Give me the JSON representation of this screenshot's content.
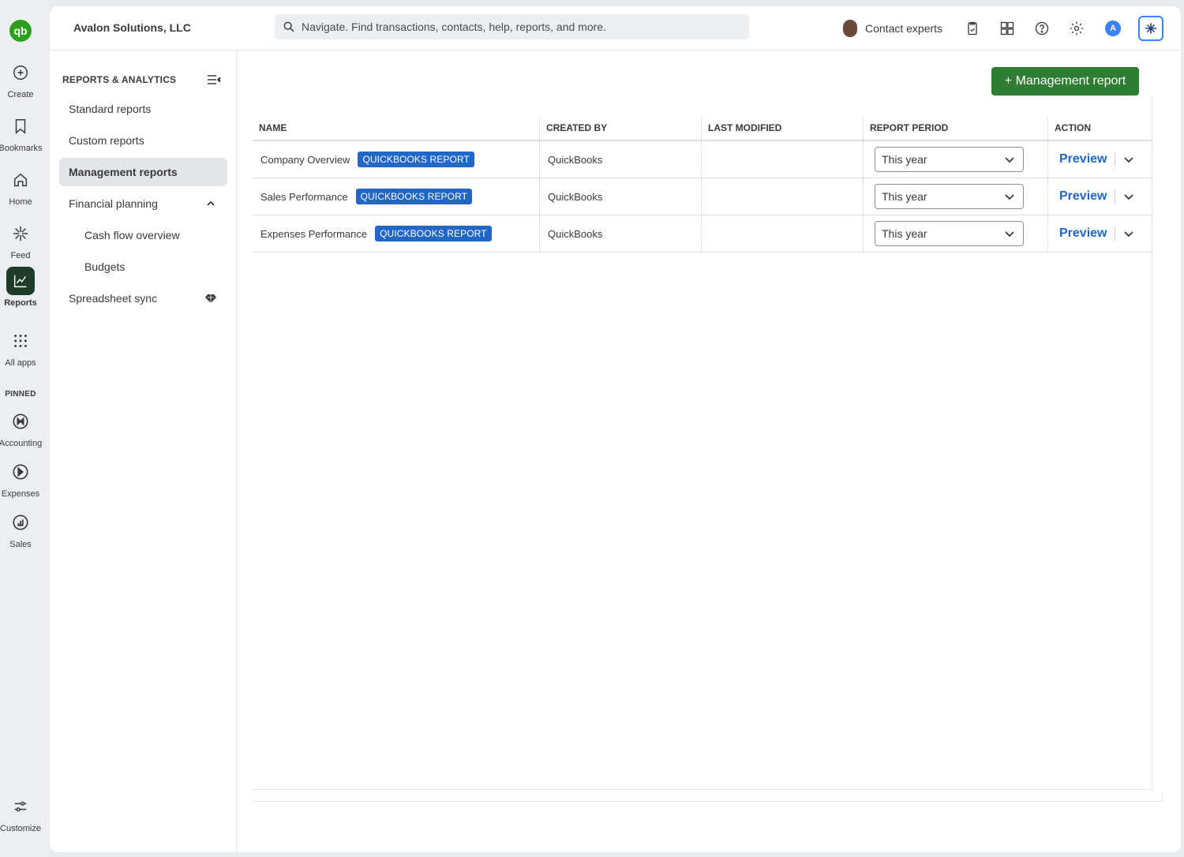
{
  "rail": {
    "items": [
      {
        "label": "Create",
        "icon": "plus-circle-icon"
      },
      {
        "label": "Bookmarks",
        "icon": "bookmark-icon"
      },
      {
        "label": "Home",
        "icon": "home-icon"
      },
      {
        "label": "Feed",
        "icon": "sparkle-icon"
      },
      {
        "label": "Reports",
        "icon": "chart-line-icon"
      },
      {
        "label": "All apps",
        "icon": "grid-icon"
      }
    ],
    "pinned_label": "PINNED",
    "pinned": [
      {
        "label": "Accounting",
        "icon": "accounting-icon"
      },
      {
        "label": "Expenses",
        "icon": "expenses-icon"
      },
      {
        "label": "Sales",
        "icon": "sales-icon"
      }
    ],
    "customize": "Customize",
    "logo": "qb"
  },
  "header": {
    "company": "Avalon Solutions, LLC",
    "search_placeholder": "Navigate. Find transactions, contacts, help, reports, and more.",
    "contact_experts": "Contact experts",
    "user_initial": "A"
  },
  "subnav": {
    "title": "REPORTS & ANALYTICS",
    "items": [
      {
        "label": "Standard reports"
      },
      {
        "label": "Custom reports"
      },
      {
        "label": "Management reports"
      },
      {
        "label": "Financial planning"
      },
      {
        "label": "Cash flow overview"
      },
      {
        "label": "Budgets"
      },
      {
        "label": "Spreadsheet sync"
      }
    ]
  },
  "main": {
    "new_button": "+ Management report",
    "columns": [
      "NAME",
      "CREATED BY",
      "LAST MODIFIED",
      "REPORT PERIOD",
      "ACTION"
    ],
    "rows": [
      {
        "name": "Company Overview",
        "badge": "QUICKBOOKS REPORT",
        "created_by": "QuickBooks",
        "last_modified": "",
        "period": "This year",
        "action": "Preview"
      },
      {
        "name": "Sales Performance",
        "badge": "QUICKBOOKS REPORT",
        "created_by": "QuickBooks",
        "last_modified": "",
        "period": "This year",
        "action": "Preview"
      },
      {
        "name": "Expenses Performance",
        "badge": "QUICKBOOKS REPORT",
        "created_by": "QuickBooks",
        "last_modified": "",
        "period": "This year",
        "action": "Preview"
      }
    ]
  },
  "colors": {
    "brand_green": "#2ca01c",
    "button_green": "#2e7d32",
    "badge_blue": "#2167c8",
    "active_rail": "#1f3b2a"
  }
}
